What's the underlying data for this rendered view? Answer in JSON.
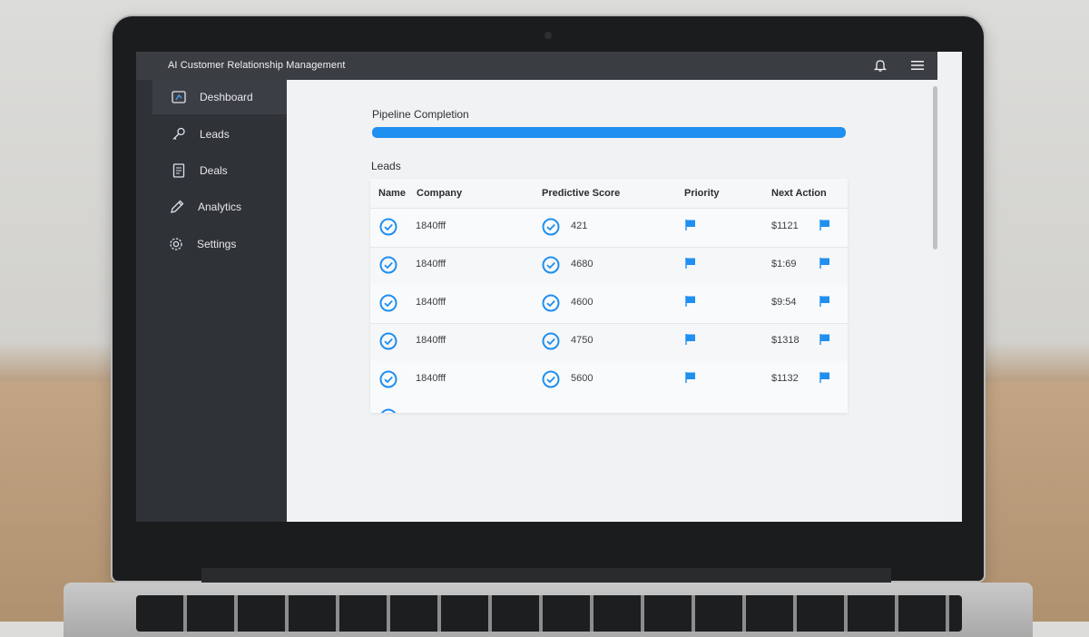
{
  "app": {
    "title": "AI Customer Relationship Management"
  },
  "sidebar": {
    "items": [
      {
        "label": "Deshboard",
        "icon": "dashboard-icon"
      },
      {
        "label": "Leads",
        "icon": "key-icon"
      },
      {
        "label": "Deals",
        "icon": "document-icon"
      },
      {
        "label": "Analytics",
        "icon": "pencil-icon"
      },
      {
        "label": "Settings",
        "icon": "gear-icon"
      }
    ]
  },
  "main": {
    "pipeline": {
      "title": "Pipeline Completion",
      "progress": 1.0
    },
    "leads": {
      "title": "Leads",
      "columns": [
        "Name",
        "Company",
        "Predictive Score",
        "Priority",
        "Next Action"
      ],
      "rows": [
        {
          "company": "1840fff",
          "score": "421",
          "next_action": "$1121"
        },
        {
          "company": "1840fff",
          "score": "4680",
          "next_action": "$1:69"
        },
        {
          "company": "1840fff",
          "score": "4600",
          "next_action": "$9:54"
        },
        {
          "company": "1840fff",
          "score": "4750",
          "next_action": "$1318"
        },
        {
          "company": "1840fff",
          "score": "5600",
          "next_action": "$1132"
        }
      ]
    }
  },
  "colors": {
    "accent": "#1f8ff0",
    "sidebar": "#2f3237",
    "titlebar": "#3a3d42"
  }
}
